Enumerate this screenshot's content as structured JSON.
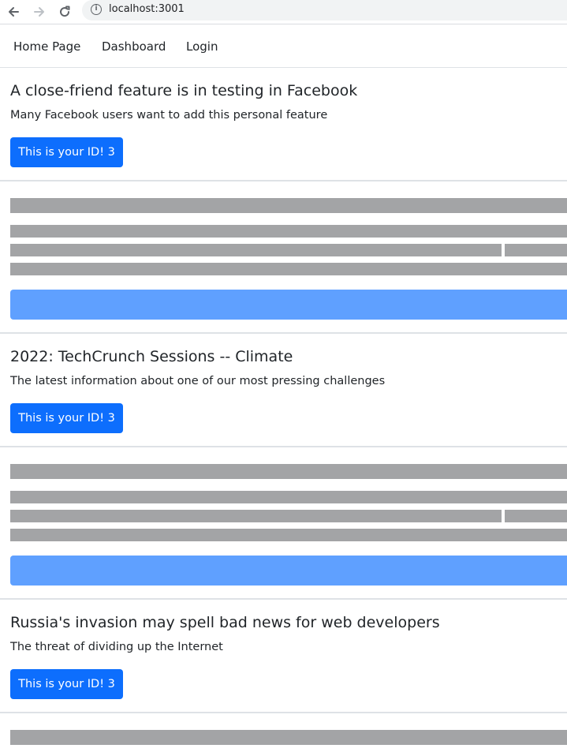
{
  "browser": {
    "back_icon": "arrow-left-icon",
    "forward_icon": "arrow-right-icon",
    "reload_icon": "reload-icon",
    "info_icon": "info-icon",
    "url": "localhost:3001"
  },
  "nav": {
    "links": [
      "Home Page",
      "Dashboard",
      "Login"
    ]
  },
  "cards": [
    {
      "title": "A close-friend feature is in testing in Facebook",
      "text": "Many Facebook users want to add this personal feature",
      "button": "This is your ID! 3"
    },
    {
      "title": "2022: TechCrunch Sessions -- Climate",
      "text": "The latest information about one of our most pressing challenges",
      "button": "This is your ID! 3"
    },
    {
      "title": "Russia's invasion may spell bad news for web developers",
      "text": "The threat of dividing up the Internet",
      "button": "This is your ID! 3"
    }
  ],
  "colors": {
    "primary": "#0d6efd",
    "placeholder_bar": "#a3a4a6",
    "placeholder_button": "#5fa0ff"
  }
}
